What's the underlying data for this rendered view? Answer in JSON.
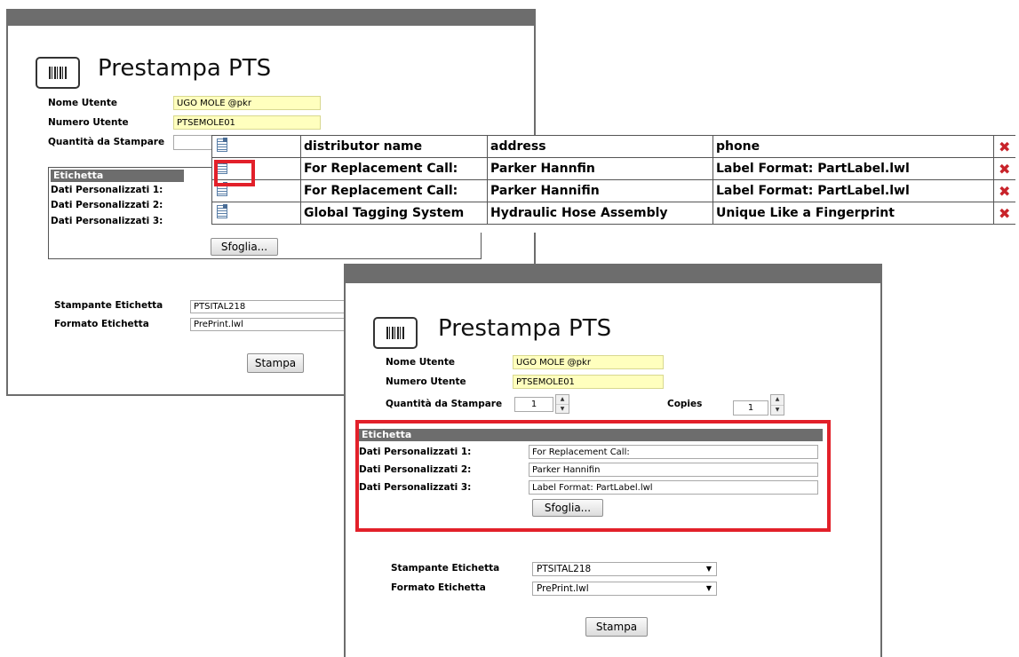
{
  "app_title": "Prestampa PTS",
  "fields": {
    "user_name_label": "Nome Utente",
    "user_name_value": "UGO MOLE @pkr",
    "user_number_label": "Numero Utente",
    "user_number_value": "PTSEMOLE01",
    "quantity_label": "Quantità da Stampare",
    "quantity_value": "1",
    "copies_label": "Copies",
    "copies_value": "1"
  },
  "etichetta": {
    "header": "Etichetta",
    "labels": [
      "Dati Personalizzati 1:",
      "Dati Personalizzati 2:",
      "Dati Personalizzati 3:"
    ],
    "values": [
      "For Replacement Call:",
      "Parker Hannifin",
      "Label Format: PartLabel.lwl"
    ],
    "browse_button": "Sfoglia..."
  },
  "printer": {
    "printer_label": "Stampante Etichetta",
    "printer_value": "PTSITAL218",
    "format_label": "Formato Etichetta",
    "format_value": "PrePrint.lwl"
  },
  "print_button": "Stampa",
  "grid": {
    "headers": [
      "distributor name",
      "address",
      "phone"
    ],
    "rows": [
      [
        "For Replacement Call:",
        "Parker Hannfin",
        "Label Format: PartLabel.lwl"
      ],
      [
        "For Replacement Call:",
        "Parker Hannifin",
        "Label Format: PartLabel.lwl"
      ],
      [
        "Global Tagging System",
        "Hydraulic Hose Assembly",
        "Unique Like a Fingerprint"
      ]
    ],
    "delete_glyph": "✖"
  },
  "colors": {
    "titlebar": "#6d6d6d",
    "field_highlight": "#ffffbe",
    "annotation_red": "#e2202a",
    "delete_red": "#c8232a"
  }
}
